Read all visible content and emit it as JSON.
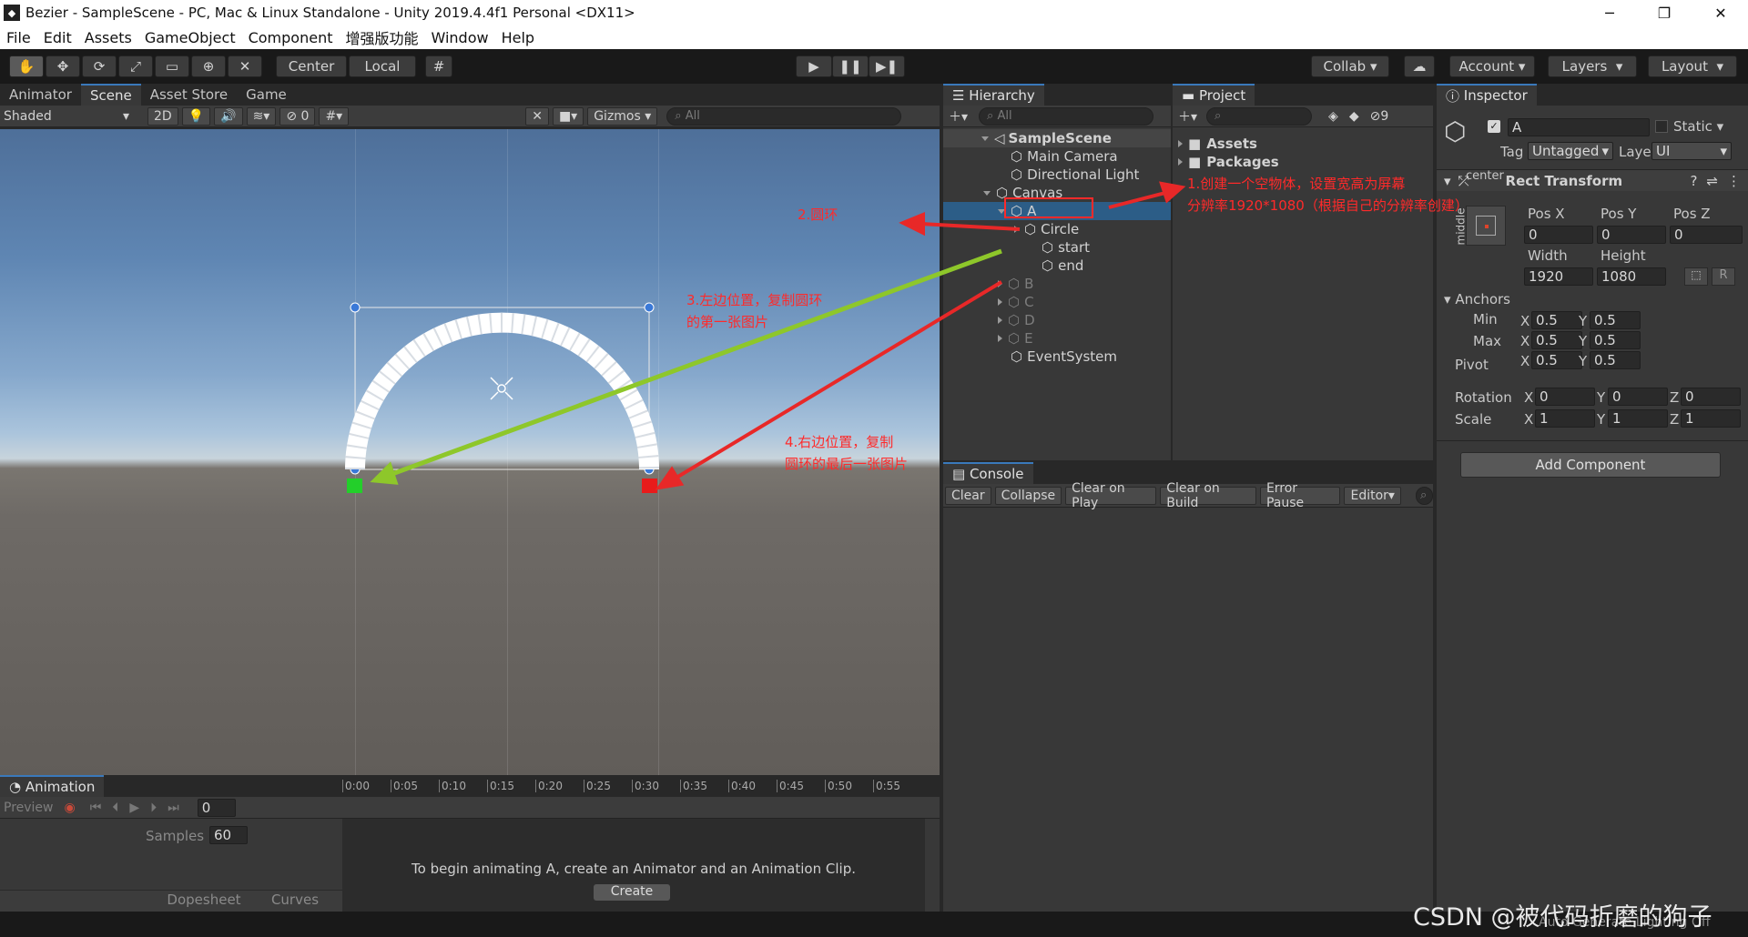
{
  "window": {
    "title": "Bezier - SampleScene - PC, Mac & Linux Standalone - Unity 2019.4.4f1 Personal <DX11>"
  },
  "menu": [
    "File",
    "Edit",
    "Assets",
    "GameObject",
    "Component",
    "增强版功能",
    "Window",
    "Help"
  ],
  "toolbar": {
    "pivot": "Center",
    "space": "Local",
    "collab": "Collab",
    "account": "Account",
    "layers": "Layers",
    "layout": "Layout"
  },
  "scene_panel": {
    "tabs": [
      "Animator",
      "Scene",
      "Asset Store",
      "Game"
    ],
    "shading": "Shaded",
    "mode_2d": "2D",
    "hidden_count": "0",
    "gizmos": "Gizmos",
    "search_placeholder": "All"
  },
  "hierarchy": {
    "tab": "Hierarchy",
    "search_placeholder": "All",
    "scene": "SampleScene",
    "items": [
      {
        "label": "Main Camera",
        "dim": false
      },
      {
        "label": "Directional Light",
        "dim": false
      },
      {
        "label": "Canvas",
        "dim": false
      },
      {
        "label": "A",
        "dim": false,
        "selected": true
      },
      {
        "label": "Circle",
        "dim": false
      },
      {
        "label": "start",
        "dim": false
      },
      {
        "label": "end",
        "dim": false
      },
      {
        "label": "B",
        "dim": true
      },
      {
        "label": "C",
        "dim": true
      },
      {
        "label": "D",
        "dim": true
      },
      {
        "label": "E",
        "dim": true
      },
      {
        "label": "EventSystem",
        "dim": false
      }
    ]
  },
  "project": {
    "tab": "Project",
    "folders": [
      "Assets",
      "Packages"
    ],
    "hidden_count": "9"
  },
  "inspector": {
    "tab": "Inspector",
    "name": "A",
    "static": "Static",
    "tag_label": "Tag",
    "tag": "Untagged",
    "layer_label": "Layer",
    "layer": "UI",
    "component": "Rect Transform",
    "anchor_h": "center",
    "anchor_v": "middle",
    "pos_labels": [
      "Pos X",
      "Pos Y",
      "Pos Z"
    ],
    "pos": [
      "0",
      "0",
      "0"
    ],
    "width_label": "Width",
    "height_label": "Height",
    "width": "1920",
    "height": "1080",
    "anchors_label": "Anchors",
    "min_label": "Min",
    "max_label": "Max",
    "pivot_label": "Pivot",
    "min": [
      "0.5",
      "0.5"
    ],
    "max": [
      "0.5",
      "0.5"
    ],
    "pivot": [
      "0.5",
      "0.5"
    ],
    "rotation_label": "Rotation",
    "scale_label": "Scale",
    "rotation": [
      "0",
      "0",
      "0"
    ],
    "scale": [
      "1",
      "1",
      "1"
    ],
    "axis": [
      "X",
      "Y",
      "Z"
    ],
    "r_button": "R",
    "add_component": "Add Component"
  },
  "console": {
    "tab": "Console",
    "buttons": [
      "Clear",
      "Collapse",
      "Clear on Play",
      "Clear on Build",
      "Error Pause",
      "Editor"
    ]
  },
  "animation": {
    "tab": "Animation",
    "preview": "Preview",
    "frame": "0",
    "samples_label": "Samples",
    "samples": "60",
    "timeline": [
      "0:00",
      "0:05",
      "0:10",
      "0:15",
      "0:20",
      "0:25",
      "0:30",
      "0:35",
      "0:40",
      "0:45",
      "0:50",
      "0:55"
    ],
    "message": "To begin animating A, create an Animator and an Animation Clip.",
    "create": "Create",
    "dopesheet": "Dopesheet",
    "curves": "Curves"
  },
  "annotations": {
    "a1_line1": "1.创建一个空物体，设置宽高为屏幕",
    "a1_line2": "分辨率1920*1080（根据自己的分辨率创建）",
    "a2": "2.圆环",
    "a3_line1": "3.左边位置，复制圆环",
    "a3_line2": "的第一张图片",
    "a4_line1": "4.右边位置，复制",
    "a4_line2": "圆环的最后一张图片"
  },
  "statusbar": {
    "text": "Auto Generate Lighting Off"
  },
  "watermark": "CSDN @被代码折磨的狗子"
}
